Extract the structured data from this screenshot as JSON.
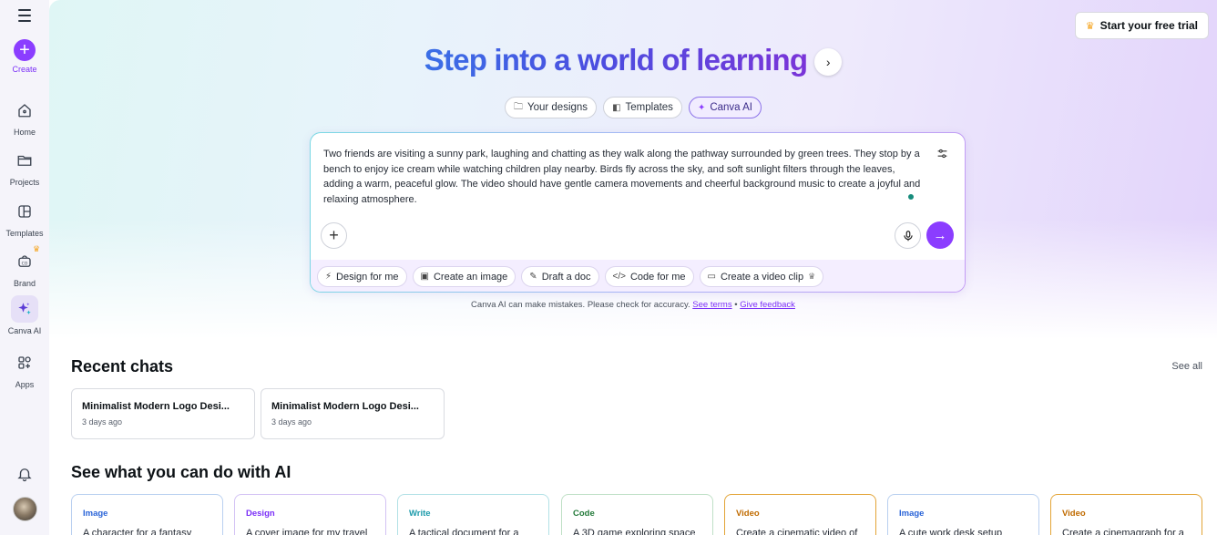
{
  "sidebar": {
    "create_label": "Create",
    "items": [
      {
        "label": "Home",
        "icon": "home-icon"
      },
      {
        "label": "Projects",
        "icon": "folder-icon"
      },
      {
        "label": "Templates",
        "icon": "templates-icon"
      },
      {
        "label": "Brand",
        "icon": "brand-icon"
      },
      {
        "label": "Canva AI",
        "icon": "sparkle-icon"
      },
      {
        "label": "Apps",
        "icon": "apps-icon"
      }
    ]
  },
  "header": {
    "trial_label": "Start your free trial"
  },
  "hero": {
    "title": "Step into a world of learning",
    "tabs": [
      {
        "label": "Your designs"
      },
      {
        "label": "Templates"
      },
      {
        "label": "Canva AI"
      }
    ]
  },
  "prompt": {
    "text": "Two friends are visiting a sunny park, laughing and chatting as they walk along the pathway surrounded by green trees. They stop by a bench to enjoy ice cream while watching children play nearby. Birds fly across the sky, and soft sunlight filters through the leaves, adding a warm, peaceful glow. The video should have gentle camera movements and cheerful background music to create a joyful and relaxing atmosphere.",
    "quick_actions": [
      {
        "label": "Design for me"
      },
      {
        "label": "Create an image"
      },
      {
        "label": "Draft a doc"
      },
      {
        "label": "Code for me"
      },
      {
        "label": "Create a video clip"
      }
    ]
  },
  "disclaimer": {
    "text": "Canva AI can make mistakes. Please check for accuracy.",
    "terms_link": "See terms",
    "separator": "•",
    "feedback_link": "Give feedback"
  },
  "recent": {
    "title": "Recent chats",
    "see_all": "See all",
    "chats": [
      {
        "title": "Minimalist Modern Logo Desi...",
        "date": "3 days ago"
      },
      {
        "title": "Minimalist Modern Logo Desi...",
        "date": "3 days ago"
      }
    ]
  },
  "ai_section": {
    "title": "See what you can do with AI",
    "cards": [
      {
        "category": "Image",
        "desc": "A character for a fantasy",
        "color": "#2a64d8",
        "border": "#b9d0f0"
      },
      {
        "category": "Design",
        "desc": "A cover image for my travel",
        "color": "#7b2ff7",
        "border": "#d3c2f4"
      },
      {
        "category": "Write",
        "desc": "A tactical document for a",
        "color": "#1b9aaa",
        "border": "#b2e1e6"
      },
      {
        "category": "Code",
        "desc": "A 3D game exploring space",
        "color": "#237a3a",
        "border": "#bfe0c6"
      },
      {
        "category": "Video",
        "desc": "Create a cinematic video of",
        "color": "#c06b00",
        "border": "#e3a437"
      },
      {
        "category": "Image",
        "desc": "A cute work desk setup",
        "color": "#2a64d8",
        "border": "#b9d0f0"
      },
      {
        "category": "Video",
        "desc": "Create a cinemagraph for a",
        "color": "#c06b00",
        "border": "#e3a437"
      }
    ]
  }
}
